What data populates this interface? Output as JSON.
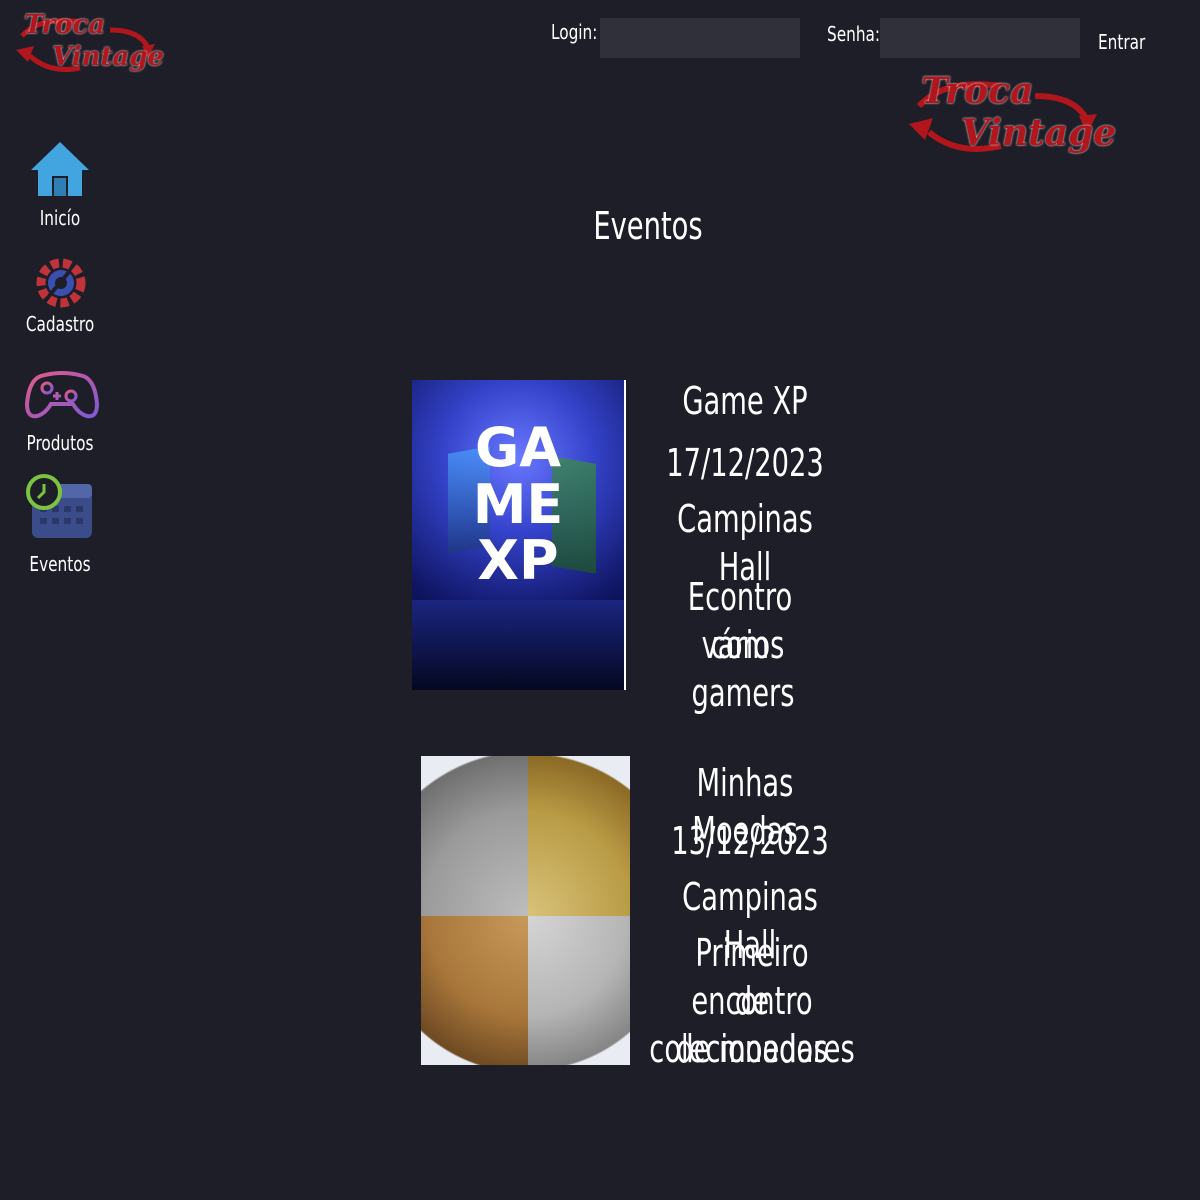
{
  "brand": {
    "line1": "Troca",
    "line2": "Vintage"
  },
  "login": {
    "login_label": "Login:",
    "password_label": "Senha:",
    "login_value": "",
    "password_value": "",
    "submit_label": "Entrar"
  },
  "sidebar": {
    "items": [
      {
        "label": "Inicío",
        "icon": "home-icon"
      },
      {
        "label": "Cadastro",
        "icon": "gear-icon"
      },
      {
        "label": "Produtos",
        "icon": "gamepad-icon"
      },
      {
        "label": "Eventos",
        "icon": "calendar-icon"
      }
    ]
  },
  "page": {
    "title": "Eventos"
  },
  "events": [
    {
      "name": "Game XP",
      "date": "17/12/2023",
      "venue": "Campinas Hall",
      "desc_line1": "Econtro com",
      "desc_line2": "vários gamers",
      "image_text": "GAME XP"
    },
    {
      "name": "Minhas Moedas",
      "date": "13/12/2023",
      "venue": "Campinas Hall",
      "desc_line1": "Primeiro encontro",
      "desc_line2": "de colecionadores",
      "desc_line3": "de moedas"
    }
  ],
  "colors": {
    "background": "#1e1e29",
    "input": "#30303b",
    "brand_red": "#b0161c"
  }
}
